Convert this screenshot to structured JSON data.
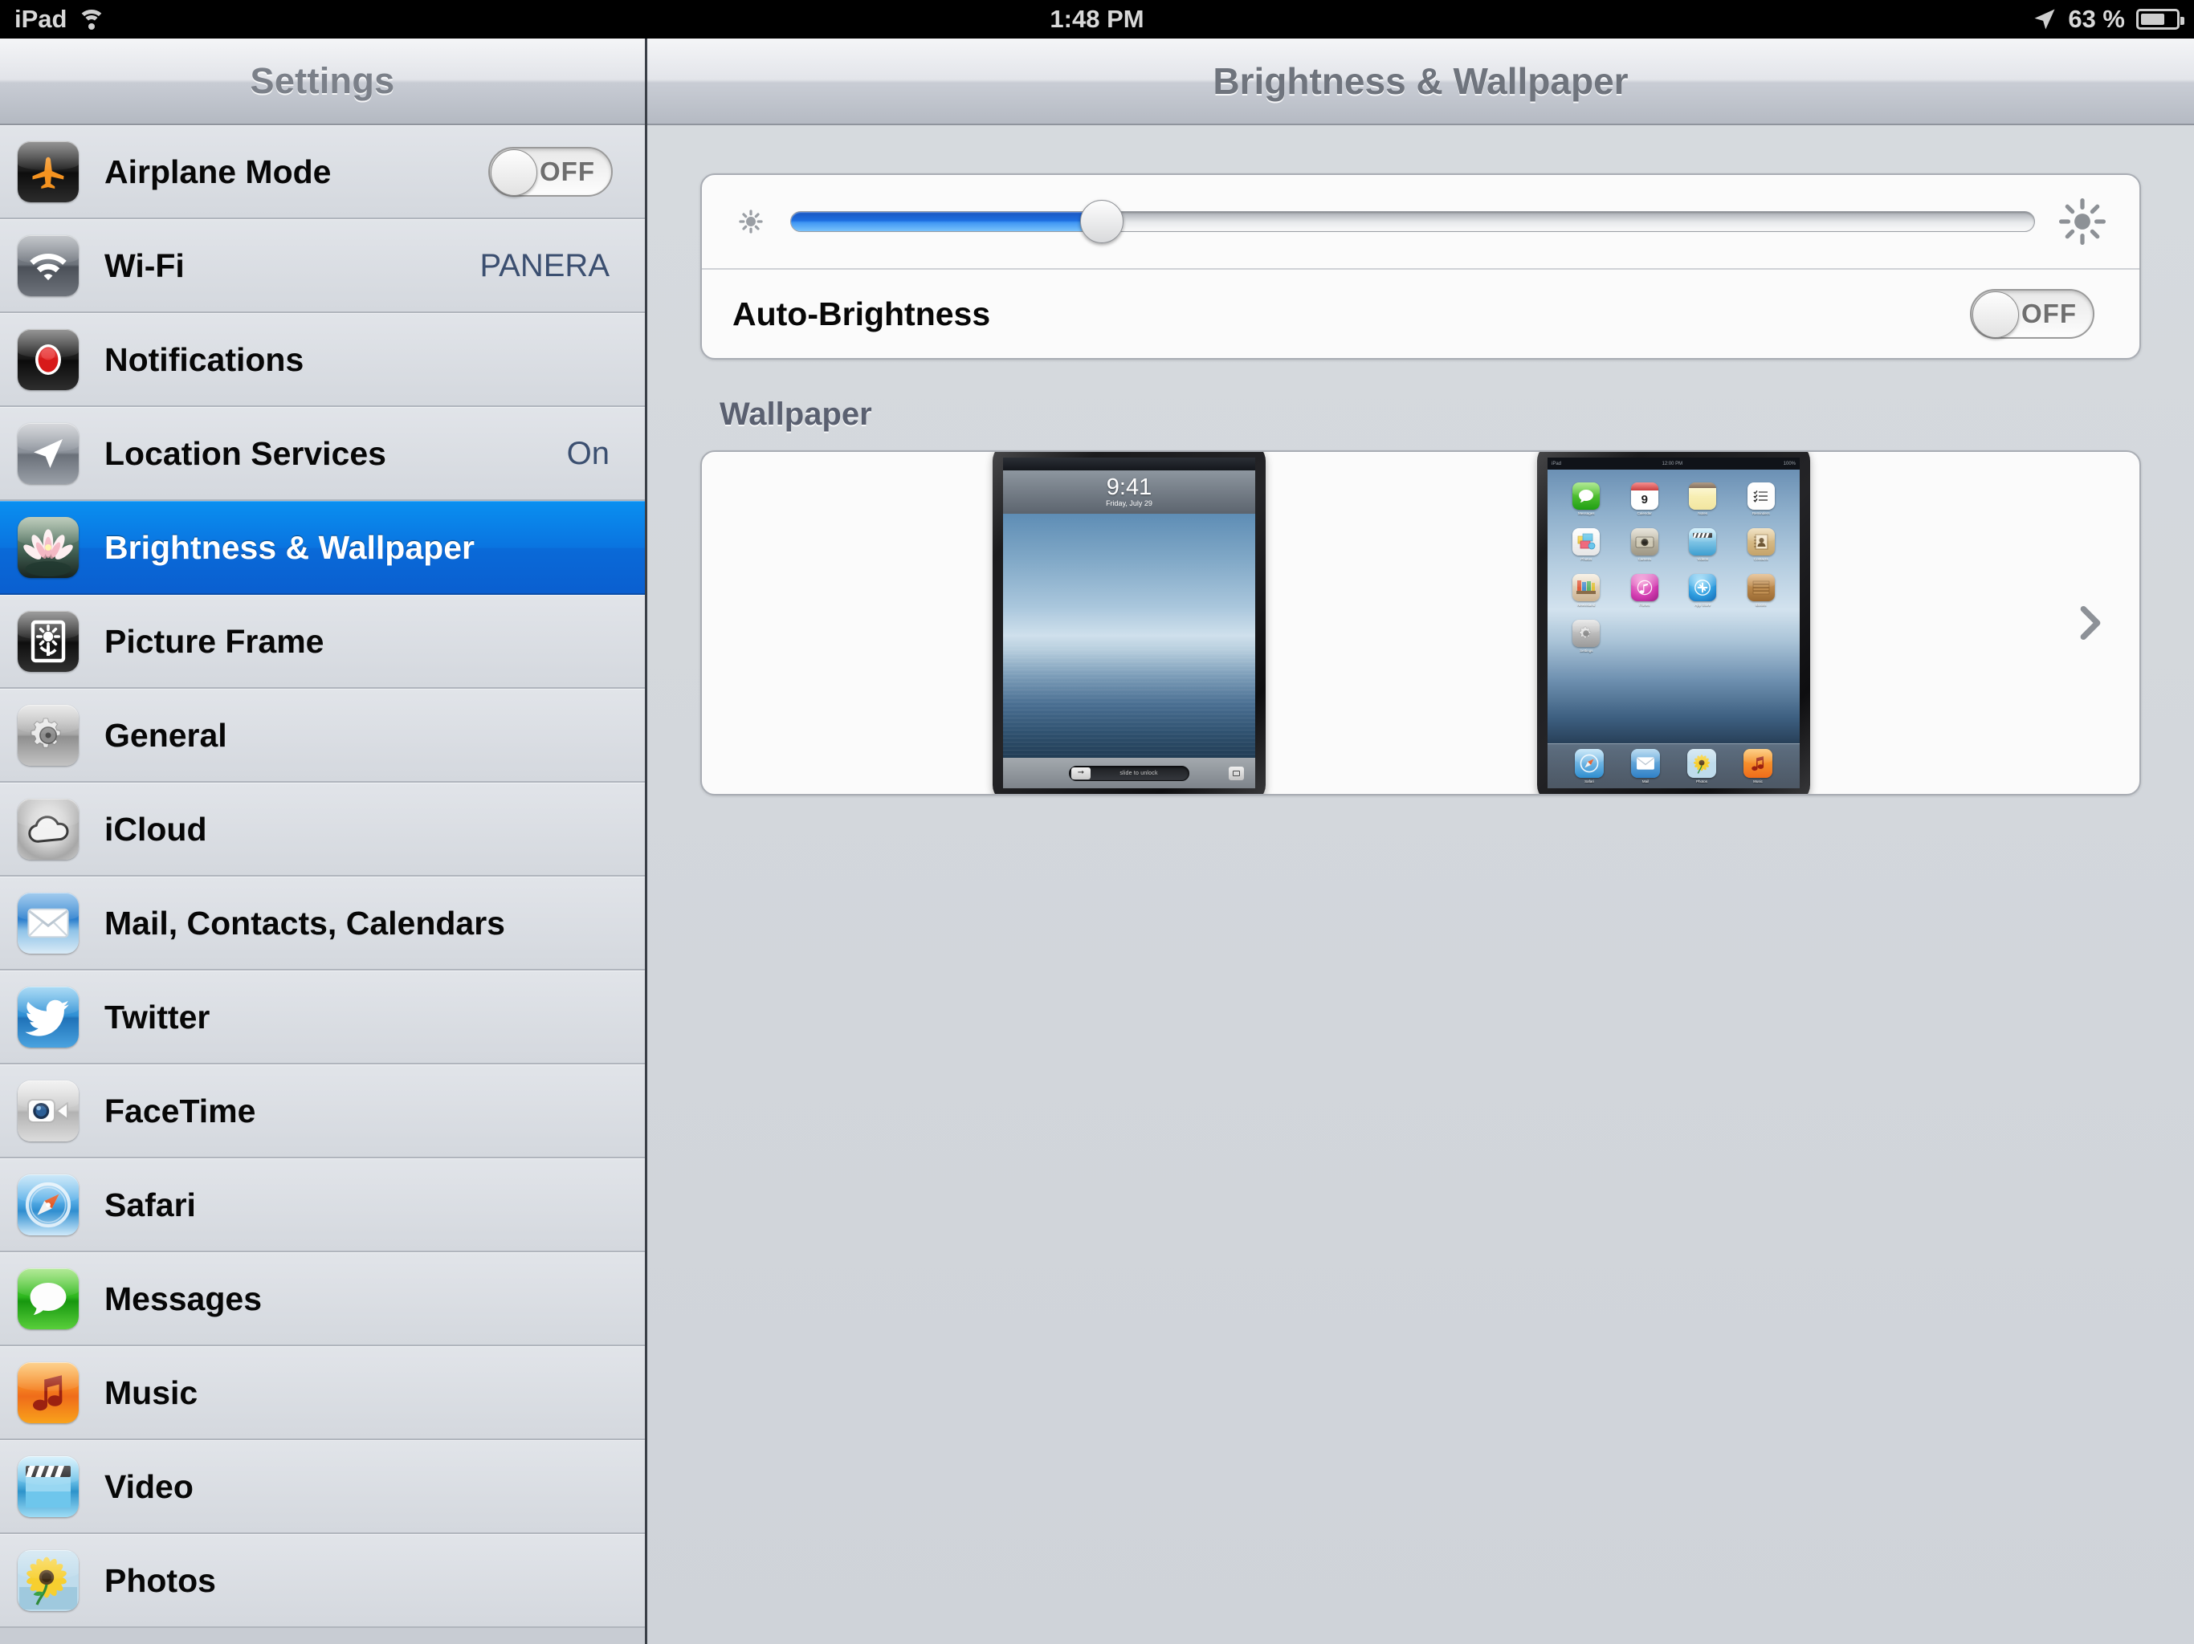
{
  "status_bar": {
    "device": "iPad",
    "wifi_icon": "wifi-icon",
    "time": "1:48 PM",
    "location_icon": "location-arrow-icon",
    "battery_percent": "63 %",
    "battery_icon": "battery-icon"
  },
  "sidebar": {
    "title": "Settings",
    "items": [
      {
        "label": "Airplane Mode",
        "icon": "airplane-icon",
        "control": "toggle",
        "value": "OFF",
        "selected": false
      },
      {
        "label": "Wi-Fi",
        "icon": "wifi-icon",
        "control": "value",
        "value": "PANERA",
        "selected": false
      },
      {
        "label": "Notifications",
        "icon": "notifications-icon",
        "control": "none",
        "value": "",
        "selected": false
      },
      {
        "label": "Location Services",
        "icon": "location-arrow-icon",
        "control": "value",
        "value": "On",
        "selected": false
      },
      {
        "label": "Brightness & Wallpaper",
        "icon": "lotus-flower-icon",
        "control": "none",
        "value": "",
        "selected": true
      },
      {
        "label": "Picture Frame",
        "icon": "picture-frame-icon",
        "control": "none",
        "value": "",
        "selected": false
      },
      {
        "label": "General",
        "icon": "gear-icon",
        "control": "none",
        "value": "",
        "selected": false
      },
      {
        "label": "iCloud",
        "icon": "cloud-icon",
        "control": "none",
        "value": "",
        "selected": false
      },
      {
        "label": "Mail, Contacts, Calendars",
        "icon": "envelope-icon",
        "control": "none",
        "value": "",
        "selected": false
      },
      {
        "label": "Twitter",
        "icon": "twitter-bird-icon",
        "control": "none",
        "value": "",
        "selected": false
      },
      {
        "label": "FaceTime",
        "icon": "video-camera-icon",
        "control": "none",
        "value": "",
        "selected": false
      },
      {
        "label": "Safari",
        "icon": "compass-icon",
        "control": "none",
        "value": "",
        "selected": false
      },
      {
        "label": "Messages",
        "icon": "speech-bubble-icon",
        "control": "none",
        "value": "",
        "selected": false
      },
      {
        "label": "Music",
        "icon": "music-note-icon",
        "control": "none",
        "value": "",
        "selected": false
      },
      {
        "label": "Video",
        "icon": "clapperboard-icon",
        "control": "none",
        "value": "",
        "selected": false
      },
      {
        "label": "Photos",
        "icon": "sunflower-icon",
        "control": "none",
        "value": "",
        "selected": false
      }
    ]
  },
  "detail": {
    "title": "Brightness & Wallpaper",
    "brightness": {
      "low_icon": "small-sun-icon",
      "high_icon": "large-sun-icon",
      "value_percent": 25
    },
    "auto_brightness": {
      "label": "Auto-Brightness",
      "toggle_value": "OFF"
    },
    "wallpaper_section": {
      "header": "Wallpaper",
      "chevron_icon": "chevron-right-icon",
      "lock_screen_preview": {
        "time": "9:41",
        "date": "Friday, July 29",
        "slide_text": "slide to unlock",
        "arrow_glyph": "➞",
        "camera_icon": "camera-icon"
      },
      "home_screen_preview": {
        "status_left": "iPad",
        "status_time": "12:00 PM",
        "status_right": "100%",
        "apps": [
          {
            "label": "Messages",
            "icon": "speech-bubble-icon"
          },
          {
            "label": "Calendar",
            "icon": "calendar-icon",
            "day": "9"
          },
          {
            "label": "Notes",
            "icon": "notes-icon"
          },
          {
            "label": "Reminders",
            "icon": "reminders-icon"
          },
          {
            "label": "Photos",
            "icon": "photos-icon"
          },
          {
            "label": "Camera",
            "icon": "camera-icon"
          },
          {
            "label": "Videos",
            "icon": "clapperboard-icon"
          },
          {
            "label": "Contacts",
            "icon": "contacts-icon"
          },
          {
            "label": "Newsstand",
            "icon": "newsstand-icon"
          },
          {
            "label": "iTunes",
            "icon": "itunes-icon"
          },
          {
            "label": "App Store",
            "icon": "appstore-icon"
          },
          {
            "label": "iBooks",
            "icon": "ibooks-icon"
          },
          {
            "label": "Settings",
            "icon": "gear-icon"
          }
        ],
        "dock": [
          {
            "label": "Safari",
            "icon": "compass-icon"
          },
          {
            "label": "Mail",
            "icon": "envelope-icon"
          },
          {
            "label": "Photos",
            "icon": "sunflower-icon"
          },
          {
            "label": "Music",
            "icon": "music-note-icon"
          }
        ]
      }
    }
  },
  "colors": {
    "selection_blue": "#0a74e0",
    "value_blue": "#3b4f70",
    "slider_blue": "#1f6fe0",
    "nav_text_gray": "#6f747d"
  }
}
